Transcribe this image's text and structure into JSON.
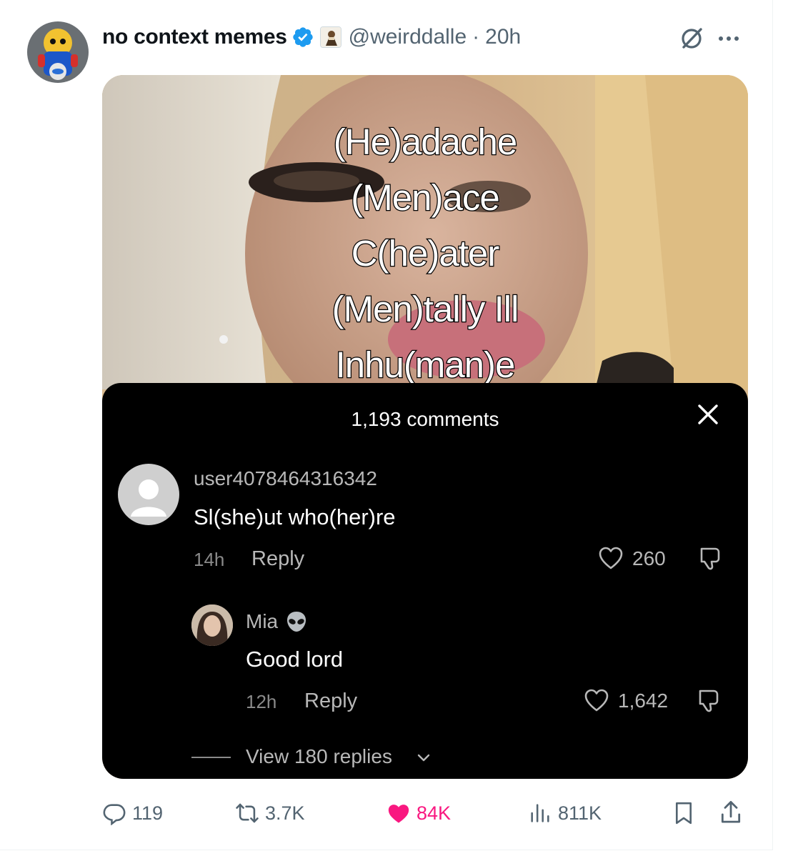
{
  "tweet": {
    "display_name": "no context memes",
    "handle": "@weirddalle",
    "separator": "·",
    "time": "20h"
  },
  "media": {
    "meme_lines": [
      "(He)adache",
      "(Men)ace",
      "C(he)ater",
      "(Men)tally Ill",
      "Inhu(man)e"
    ],
    "comments_panel": {
      "title": "1,193 comments",
      "comment": {
        "user": "user4078464316342",
        "text": "Sl(she)ut who(her)re",
        "time": "14h",
        "reply_label": "Reply",
        "likes": "260"
      },
      "reply": {
        "user": "Mia",
        "text": "Good lord",
        "time": "12h",
        "reply_label": "Reply",
        "likes": "1,642"
      },
      "view_replies": "View 180 replies"
    }
  },
  "actions": {
    "replies": "119",
    "reposts": "3.7K",
    "likes": "84K",
    "views": "811K"
  },
  "colors": {
    "verified": "#1d9bf0",
    "liked": "#f91880",
    "muted": "#536471"
  }
}
